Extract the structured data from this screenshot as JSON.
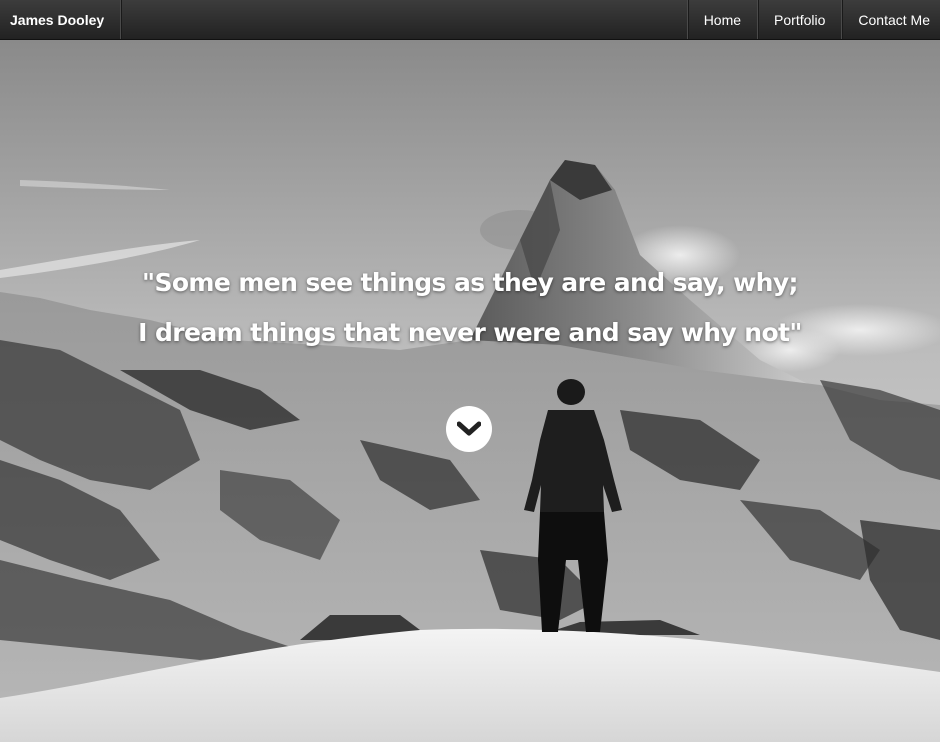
{
  "navbar": {
    "brand": "James Dooley",
    "links": [
      {
        "label": "Home"
      },
      {
        "label": "Portfolio"
      },
      {
        "label": "Contact Me"
      }
    ]
  },
  "hero": {
    "quote_line1": "\"Some men see things as they are and say, why;",
    "quote_line2": "I dream things that never were and say why not\"",
    "scroll_icon": "chevron-down-icon",
    "background": "black-and-white mountain photograph"
  }
}
